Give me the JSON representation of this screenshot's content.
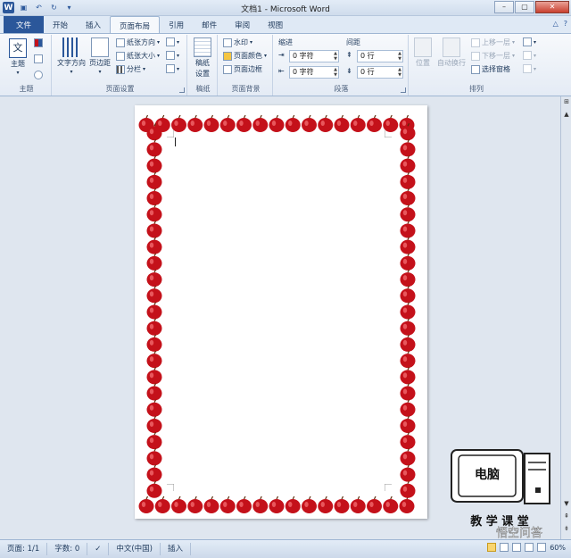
{
  "window": {
    "title": "文档1 - Microsoft Word"
  },
  "quick_access": {
    "icons": [
      "word-logo",
      "save-icon",
      "undo-icon",
      "redo-icon",
      "customize-icon"
    ],
    "word_letter": "W"
  },
  "tabs": [
    {
      "label": "文件",
      "name": "file"
    },
    {
      "label": "开始",
      "name": "home"
    },
    {
      "label": "插入",
      "name": "insert"
    },
    {
      "label": "页面布局",
      "name": "page-layout"
    },
    {
      "label": "引用",
      "name": "references"
    },
    {
      "label": "邮件",
      "name": "mailings"
    },
    {
      "label": "审阅",
      "name": "review"
    },
    {
      "label": "视图",
      "name": "view"
    }
  ],
  "active_tab": "页面布局",
  "ribbon": {
    "themes": {
      "label": "主题",
      "theme_button": "主题",
      "glyph": "文"
    },
    "page_setup": {
      "label": "页面设置",
      "text_direction": "文字方向",
      "margins": "页边距",
      "orientation": "纸张方向",
      "size": "纸张大小",
      "columns": "分栏"
    },
    "manuscript": {
      "label": "稿纸",
      "button_line1": "稿纸",
      "button_line2": "设置"
    },
    "page_background": {
      "label": "页面背景",
      "watermark": "水印",
      "page_color": "页面颜色",
      "page_borders": "页面边框"
    },
    "paragraph": {
      "label": "段落",
      "indent_label": "缩进",
      "spacing_label": "间距",
      "indent_left": "0 字符",
      "indent_right": "0 字符",
      "spacing_before": "0 行",
      "spacing_after": "0 行"
    },
    "arrange": {
      "label": "排列",
      "position": "位置",
      "wrap_text": "自动换行",
      "bring_forward": "上移一层",
      "send_backward": "下移一层",
      "selection_pane": "选择窗格"
    }
  },
  "status": {
    "page": "页面: 1/1",
    "words": "字数: 0",
    "language": "中文(中国)",
    "mode": "插入",
    "zoom": "60%"
  },
  "watermark_logo": {
    "line1": "电脑",
    "line2": "教 学 课 堂",
    "overlay": "悟空问答"
  },
  "colors": {
    "border_apple": "#c4111a",
    "file_tab": "#2b579a"
  }
}
